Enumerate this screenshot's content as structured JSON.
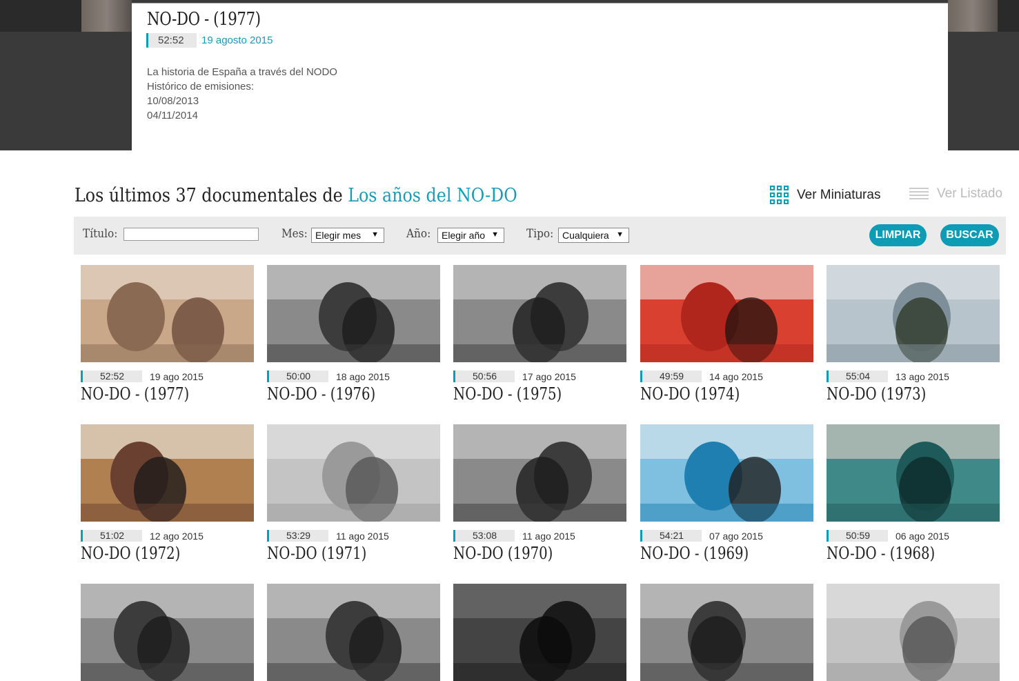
{
  "hero": {
    "title": "NO-DO - (1977)",
    "duration": "52:52",
    "date": "19 agosto 2015",
    "description": [
      "La historia de España a través del NODO",
      "Histórico de emisiones:",
      "10/08/2013",
      "04/11/2014"
    ]
  },
  "section": {
    "title_prefix": "Los últimos 37 documentales de ",
    "title_link": "Los años del NO-DO",
    "view_thumbs": "Ver Miniaturas",
    "view_list": "Ver Listado"
  },
  "filters": {
    "titulo_label": "Título:",
    "mes_label": "Mes:",
    "mes_value": "Elegir mes",
    "ano_label": "Año:",
    "ano_value": "Elegir año",
    "tipo_label": "Tipo:",
    "tipo_value": "Cualquiera",
    "clear": "LIMPIAR",
    "search": "BUSCAR"
  },
  "videos": [
    {
      "duration": "52:52",
      "date": "19 ago 2015",
      "title": "NO-DO - (1977)",
      "tone": "color-warm"
    },
    {
      "duration": "50:00",
      "date": "18 ago 2015",
      "title": "NO-DO - (1976)",
      "tone": "bw"
    },
    {
      "duration": "50:56",
      "date": "17 ago 2015",
      "title": "NO-DO - (1975)",
      "tone": "bw"
    },
    {
      "duration": "49:59",
      "date": "14 ago 2015",
      "title": "NO-DO (1974)",
      "tone": "red"
    },
    {
      "duration": "55:04",
      "date": "13 ago 2015",
      "title": "NO-DO (1973)",
      "tone": "color-city"
    },
    {
      "duration": "51:02",
      "date": "12 ago 2015",
      "title": "NO-DO (1972)",
      "tone": "color-wedding"
    },
    {
      "duration": "53:29",
      "date": "11 ago 2015",
      "title": "NO-DO (1971)",
      "tone": "bw-light"
    },
    {
      "duration": "53:08",
      "date": "11 ago 2015",
      "title": "NO-DO (1970)",
      "tone": "bw"
    },
    {
      "duration": "54:21",
      "date": "07 ago 2015",
      "title": "NO-DO - (1969)",
      "tone": "color-sea"
    },
    {
      "duration": "50:59",
      "date": "06 ago 2015",
      "title": "NO-DO - (1968)",
      "tone": "color-singer"
    },
    {
      "tone": "bw"
    },
    {
      "tone": "bw"
    },
    {
      "tone": "bw-dark"
    },
    {
      "tone": "bw"
    },
    {
      "tone": "bw-light"
    }
  ],
  "colors": {
    "accent": "#0e9bb5",
    "hero_bg": "#3a3a3a",
    "filter_bg": "#ebebeb"
  }
}
